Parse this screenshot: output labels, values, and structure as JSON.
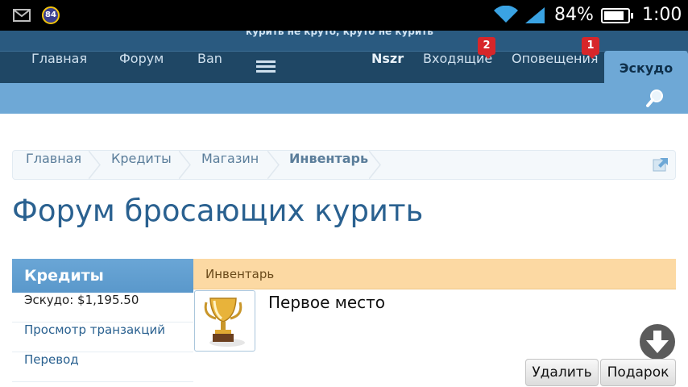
{
  "status_bar": {
    "notification_count": "84",
    "battery_percent": "84%",
    "battery_level": 0.84,
    "time": "1:00",
    "icons": [
      "mail-icon",
      "wifi-icon",
      "signal-icon",
      "battery-icon"
    ]
  },
  "header": {
    "tagline": "курить не круто, круто не курить",
    "nav": {
      "home": "Главная",
      "forum": "Форум",
      "ban": "Ban",
      "username": "Nszr",
      "inbox": "Входящие",
      "inbox_badge": "2",
      "alerts": "Оповещения",
      "alerts_badge": "1",
      "active_tab": "Эскудо"
    }
  },
  "breadcrumb": {
    "items": [
      "Главная",
      "Кредиты",
      "Магазин",
      "Инвентарь"
    ]
  },
  "page_title": "Форум бросающих курить",
  "sidebar": {
    "title": "Кредиты",
    "balance": "Эскудо: $1,195.50",
    "links": [
      "Просмотр транзакций",
      "Перевод"
    ]
  },
  "inventory": {
    "title": "Инвентарь",
    "item_name": "Первое место",
    "item_icon": "trophy-icon",
    "buttons": {
      "delete": "Удалить",
      "gift": "Подарок"
    }
  },
  "colors": {
    "header_dark": "#1f4765",
    "accent_blue": "#6ea8d6",
    "link": "#2a6190",
    "badge_red": "#d7262a",
    "inventory_header": "#fcd9a3"
  }
}
